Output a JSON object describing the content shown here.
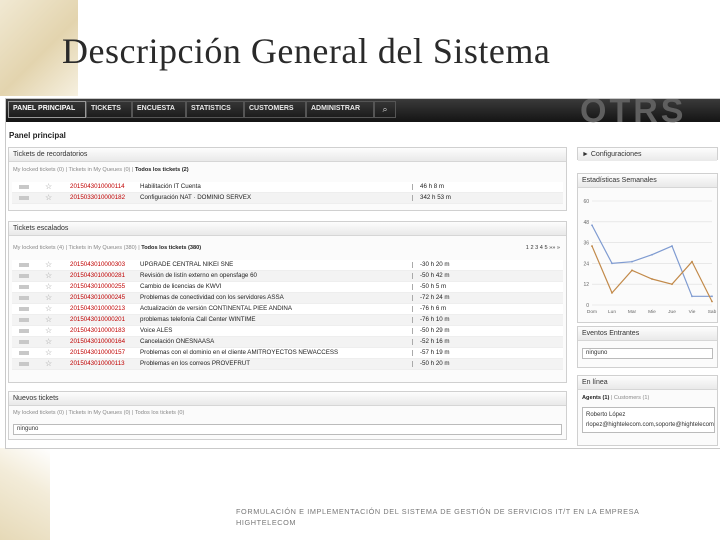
{
  "slide": {
    "title": "Descripción General del Sistema",
    "caption": "FORMULACIÓN E IMPLEMENTACIÓN DEL SISTEMA DE GESTIÓN DE SERVICIOS IT/T EN LA EMPRESA HIGHTELECOM"
  },
  "nav": {
    "items": [
      "PANEL PRINCIPAL",
      "TICKETS",
      "ENCUESTA",
      "STATISTICS",
      "CUSTOMERS",
      "ADMINISTRAR"
    ],
    "active": "PANEL PRINCIPAL",
    "search_icon": "search-icon",
    "logo": "OTRS"
  },
  "page_heading": "Panel principal",
  "reminder": {
    "title": "Tickets de recordatorios",
    "tab_mine": "My locked tickets (0)",
    "tab_queues": "Tickets in My Queues (0)",
    "tab_all": "Todos los tickets (2)",
    "rows": [
      {
        "number": "2015043010000114",
        "subject": "Habilitación IT Cuenta",
        "age": "46 h 8 m"
      },
      {
        "number": "2015033010000182",
        "subject": "Configuración NAT · DOMINIO SERVEX",
        "age": "342 h 53 m"
      }
    ]
  },
  "escalated": {
    "title": "Tickets escalados",
    "tab_mine": "My locked tickets (4)",
    "tab_queues": "Tickets in My Queues (380)",
    "tab_all": "Todos los tickets (380)",
    "pager": "1 2 3 4 5 »» »",
    "rows": [
      {
        "number": "2015043010000303",
        "subject": "UPGRADE CENTRAL NIKEI SNE",
        "age": "-30 h 20 m"
      },
      {
        "number": "2015043010000281",
        "subject": "Revisión de listín externo en opensfage 60",
        "age": "-50 h 42 m"
      },
      {
        "number": "2015043010000255",
        "subject": "Cambio de licencias de KWVI",
        "age": "-50 h 5 m"
      },
      {
        "number": "2015043010000245",
        "subject": "Problemas de conectividad con los servidores ASSA",
        "age": "-72 h 24 m"
      },
      {
        "number": "2015043010000213",
        "subject": "Actualización de versión CONTINENTAL PIEE ANDINA",
        "age": "-76 h 6 m"
      },
      {
        "number": "2015043010000201",
        "subject": "problemas telefonía Call Center WINTIME",
        "age": "-76 h 10 m"
      },
      {
        "number": "2015043010000183",
        "subject": "Voice ALES",
        "age": "-50 h 29 m"
      },
      {
        "number": "2015043010000164",
        "subject": "Cancelación ONESNAASA",
        "age": "-52 h 16 m"
      },
      {
        "number": "2015043010000157",
        "subject": "Problemas con el dominio en el cliente AMITROYECTOS NEWACCESS",
        "age": "-57 h 19 m"
      },
      {
        "number": "2015043010000113",
        "subject": "Problemas en los correos PROVEFRUT",
        "age": "-50 h 20 m"
      }
    ]
  },
  "newtickets": {
    "title": "Nuevos tickets",
    "tab_mine": "My locked tickets (0)",
    "tab_queues": "Tickets in My Queues (0)",
    "tab_all": "Todos los tickets (0)",
    "empty": "ninguno"
  },
  "sidebar": {
    "config": "► Configuraciones",
    "weekly": "Estadísticas Semanales",
    "events": "Eventos Entrantes",
    "events_empty": "ninguno",
    "online": "En línea",
    "online_tab_agents": "Agents (1)",
    "online_tab_customers": "Customers (1)",
    "online_user_name": "Roberto López",
    "online_user_email": "rlopez@hightelecom.com,soporte@hightelecom"
  },
  "chart_data": {
    "type": "line",
    "categories": [
      "Dom",
      "Lun",
      "Mar",
      "Mie",
      "Jue",
      "Vie",
      "Sab"
    ],
    "y_ticks": [
      "60",
      "48",
      "36",
      "24",
      "12",
      "0"
    ],
    "ylim": [
      0,
      60
    ],
    "grid": true,
    "series": [
      {
        "values": [
          46,
          24,
          25,
          29,
          34,
          5,
          5
        ],
        "color": "#7f9bd1"
      },
      {
        "values": [
          34,
          7,
          20,
          15,
          12,
          25,
          2
        ],
        "color": "#c28a4a"
      }
    ]
  }
}
